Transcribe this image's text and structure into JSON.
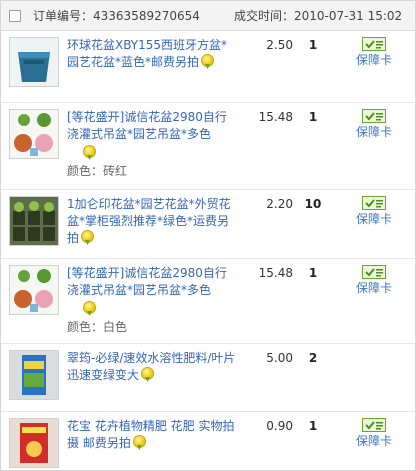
{
  "header": {
    "order_label": "订单编号：",
    "order_number": "43363589270654",
    "time_label": "成交时间：",
    "time_value": "2010-07-31 15:02"
  },
  "guarantee_label": "保障卡",
  "items": [
    {
      "title": "环球花盆XBY155西班牙方盆*园艺花盆*蓝色*邮费另拍",
      "price": "2.50",
      "qty": "1"
    },
    {
      "title": "[等花盛开]诚信花盆2980自行浇灌式吊盆*园艺吊盆*多色",
      "price": "15.48",
      "qty": "1",
      "attr_label": "颜色：",
      "attr_value": "砖红"
    },
    {
      "title": "1加仑印花盆*园艺花盆*外贸花盆*掌柜强烈推荐*绿色*运费另拍",
      "price": "2.20",
      "qty": "10"
    },
    {
      "title": "[等花盛开]诚信花盆2980自行浇灌式吊盆*园艺吊盆*多色",
      "price": "15.48",
      "qty": "1",
      "attr_label": "颜色：",
      "attr_value": "白色"
    },
    {
      "title": "翠筠-必绿/速效水溶性肥料/叶片迅速变绿变大",
      "price": "5.00",
      "qty": "2"
    },
    {
      "title": "花宝 花卉植物精肥 花肥 实物拍摄 邮费另拍",
      "price": "0.90",
      "qty": "1"
    }
  ],
  "colors": {
    "link": "#3366bb",
    "guarantee_link": "#3a77c6",
    "guarantee_icon_border": "#6aa62b",
    "header_bg": "#f3f3f3"
  },
  "icons": {
    "medal": "yellow-medal-icon",
    "guarantee": "guarantee-card-icon"
  }
}
